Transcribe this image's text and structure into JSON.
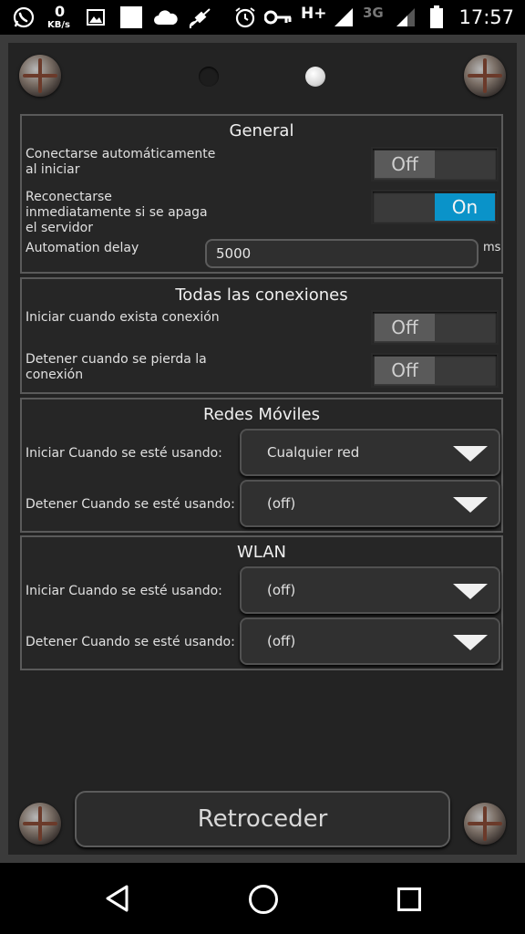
{
  "status_bar": {
    "net_speed_value": "0",
    "net_speed_unit": "KB/s",
    "network_type_hplus": "H+",
    "network_type_3g": "3G",
    "time": "17:57"
  },
  "general": {
    "title": "General",
    "auto_connect_label": "Conectarse automáticamente\nal iniciar",
    "auto_connect_value": "Off",
    "reconnect_label": "Reconectarse\ninmediatamente si se apaga\nel servidor",
    "reconnect_value": "On",
    "automation_delay_label": "Automation delay",
    "automation_delay_value": "5000",
    "automation_delay_unit": "ms"
  },
  "all_connections": {
    "title": "Todas las conexiones",
    "start_label": "Iniciar cuando exista conexión",
    "start_value": "Off",
    "stop_label": "Detener cuando se pierda la\nconexión",
    "stop_value": "Off"
  },
  "mobile_networks": {
    "title": "Redes Móviles",
    "start_label": "Iniciar Cuando se esté usando:",
    "start_value": "Cualquier red",
    "stop_label": "Detener Cuando se esté usando:",
    "stop_value": "(off)"
  },
  "wlan": {
    "title": "WLAN",
    "start_label": "Iniciar Cuando se esté usando:",
    "start_value": "(off)",
    "stop_label": "Detener Cuando se esté usando:",
    "stop_value": "(off)"
  },
  "back_button": {
    "label": "Retroceder"
  },
  "page_indicator": {
    "pages": 2,
    "current": 2
  },
  "colors": {
    "toggle_on": "#0a93c9",
    "toggle_off": "#5a5a5a",
    "background": "#232323"
  }
}
